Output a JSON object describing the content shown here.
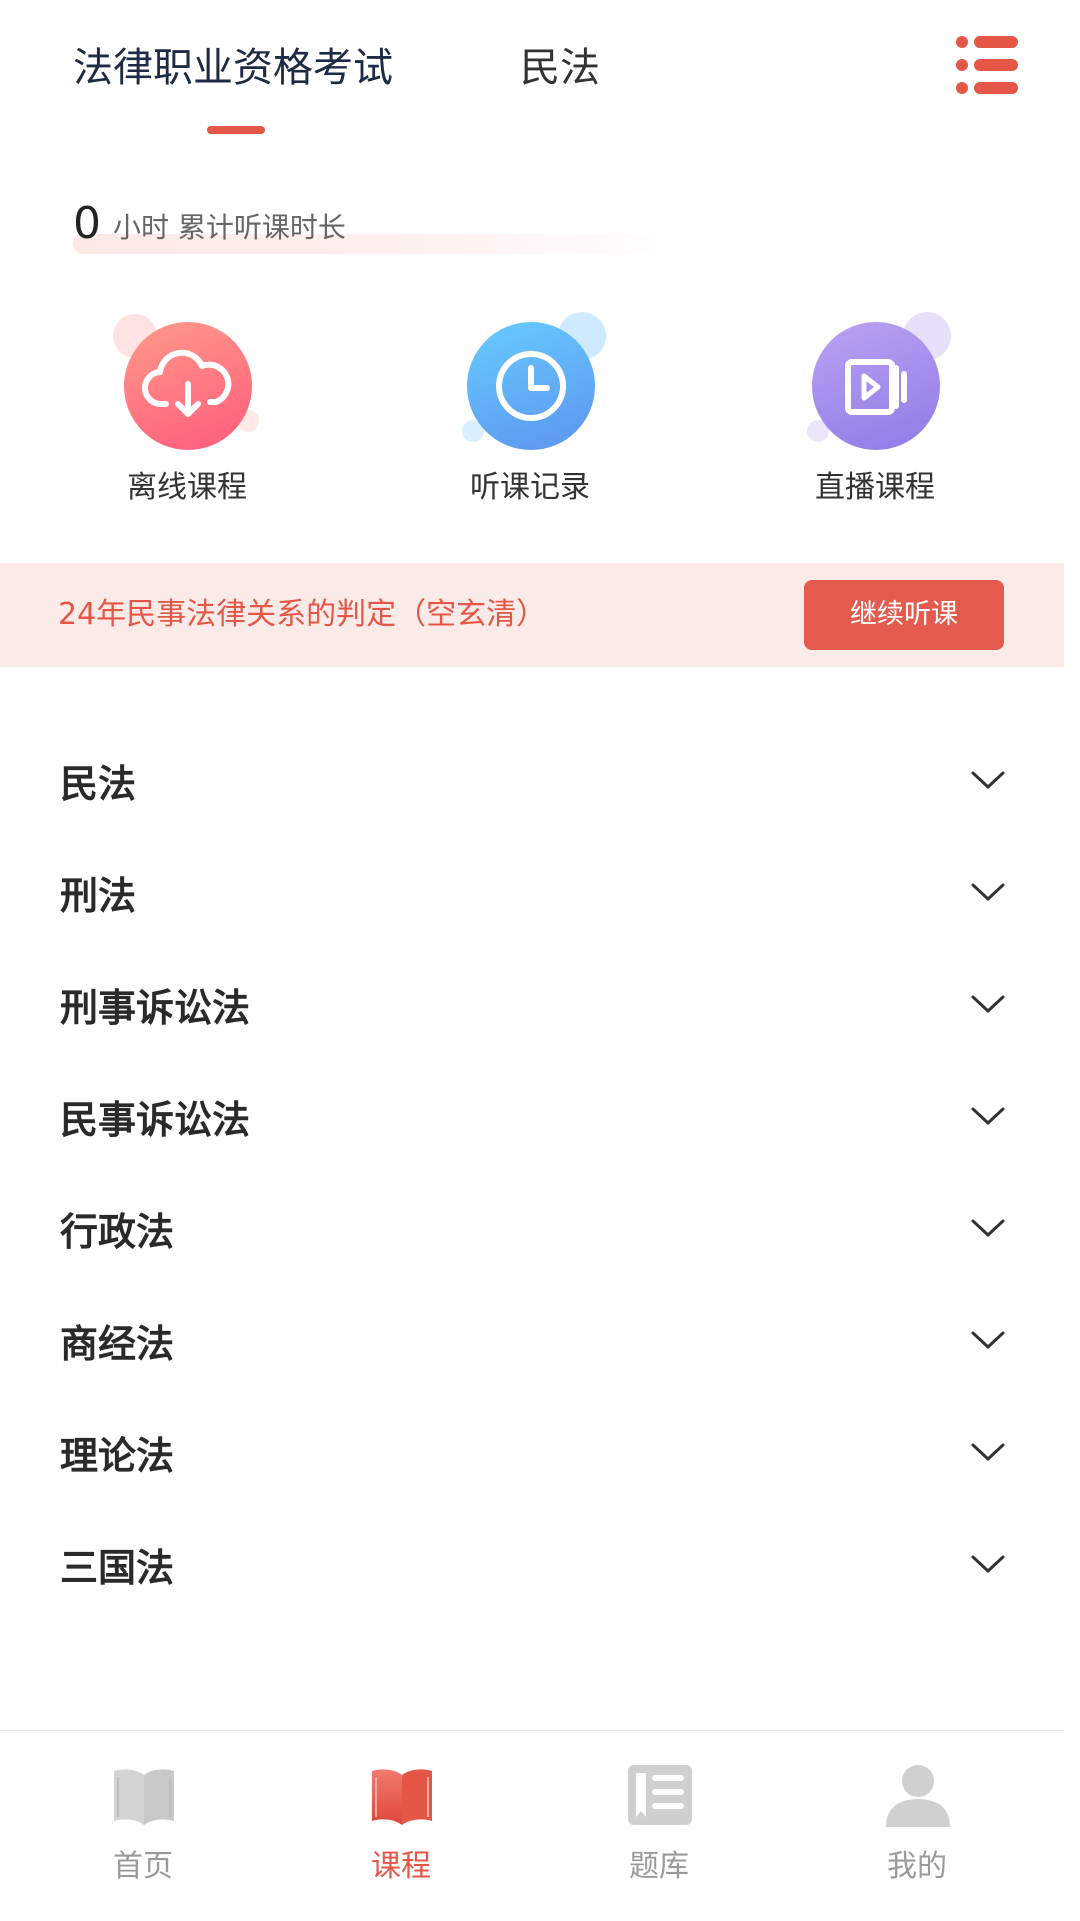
{
  "header": {
    "tabs": [
      {
        "label": "法律职业资格考试",
        "active": true
      },
      {
        "label": "民法",
        "active": false
      }
    ],
    "menu_icon": "list-menu-icon",
    "accent_color": "#e45646"
  },
  "study_time": {
    "hours": "0",
    "label": "小时 累计听课时长"
  },
  "shortcuts": [
    {
      "label": "离线课程",
      "icon": "cloud-download-icon",
      "color_from": "#ff8a80",
      "color_to": "#ff5c7a"
    },
    {
      "label": "听课记录",
      "icon": "clock-icon",
      "color_from": "#6cc6ff",
      "color_to": "#5a9cf0"
    },
    {
      "label": "直播课程",
      "icon": "video-play-icon",
      "color_from": "#b79cf2",
      "color_to": "#8f7ce8"
    }
  ],
  "continue_banner": {
    "text": "24年民事法律关系的判定（空玄清）",
    "button_label": "继续听课"
  },
  "subjects": [
    {
      "label": "民法"
    },
    {
      "label": "刑法"
    },
    {
      "label": "刑事诉讼法"
    },
    {
      "label": "民事诉讼法"
    },
    {
      "label": "行政法"
    },
    {
      "label": "商经法"
    },
    {
      "label": "理论法"
    },
    {
      "label": "三国法"
    }
  ],
  "bottom_nav": [
    {
      "label": "首页",
      "icon": "book-open-icon",
      "active": false
    },
    {
      "label": "课程",
      "icon": "book-open-icon",
      "active": true
    },
    {
      "label": "题库",
      "icon": "question-bank-icon",
      "active": false
    },
    {
      "label": "我的",
      "icon": "user-icon",
      "active": false
    }
  ]
}
